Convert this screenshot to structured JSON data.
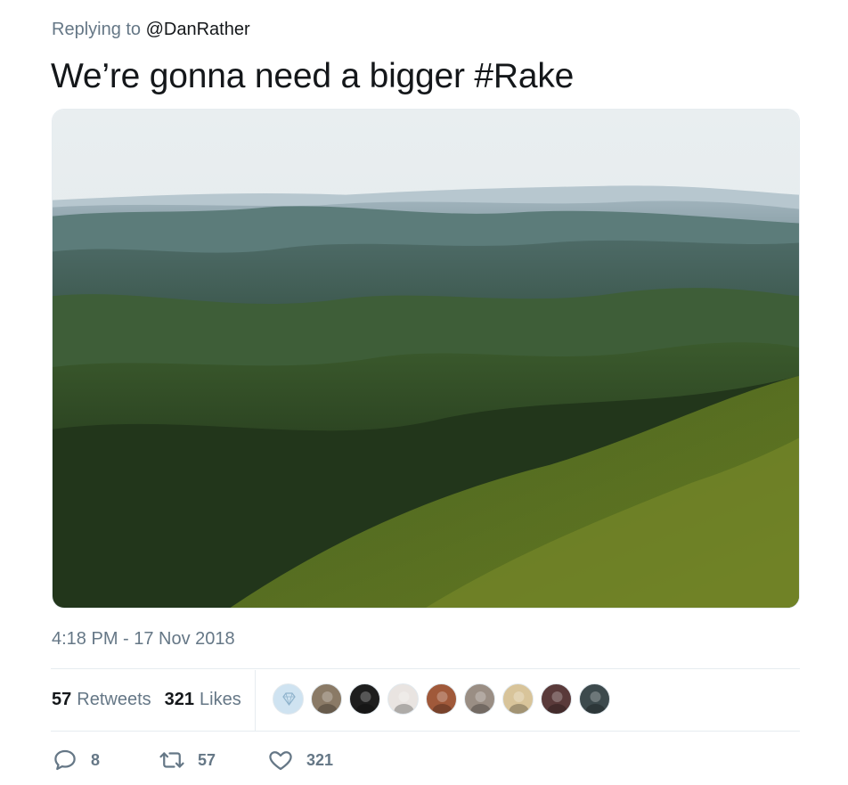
{
  "reply": {
    "prefix": "Replying to",
    "handle": "@DanRather"
  },
  "tweet": {
    "text": "We’re gonna need a bigger #Rake"
  },
  "timestamp": "4:18 PM - 17 Nov 2018",
  "stats": {
    "retweets_count": "57",
    "retweets_label": "Retweets",
    "likes_count": "321",
    "likes_label": "Likes"
  },
  "avatars": [
    {
      "name": "avatar-diamond-logo",
      "color": "#cfe3f1"
    },
    {
      "name": "avatar-user-2",
      "color": "#8a7a66"
    },
    {
      "name": "avatar-user-3",
      "color": "#1e1e1e"
    },
    {
      "name": "avatar-user-4",
      "color": "#e9e4e1"
    },
    {
      "name": "avatar-user-5",
      "color": "#a0593a"
    },
    {
      "name": "avatar-user-6",
      "color": "#9a8e84"
    },
    {
      "name": "avatar-user-7",
      "color": "#d8c49a"
    },
    {
      "name": "avatar-user-8",
      "color": "#5a3a3a"
    },
    {
      "name": "avatar-user-9",
      "color": "#3d4a4d"
    }
  ],
  "actions": {
    "replies": "8",
    "retweets": "57",
    "likes": "321"
  },
  "colors": {
    "muted": "#657786",
    "text": "#14171a",
    "divider": "#e6ecf0"
  }
}
